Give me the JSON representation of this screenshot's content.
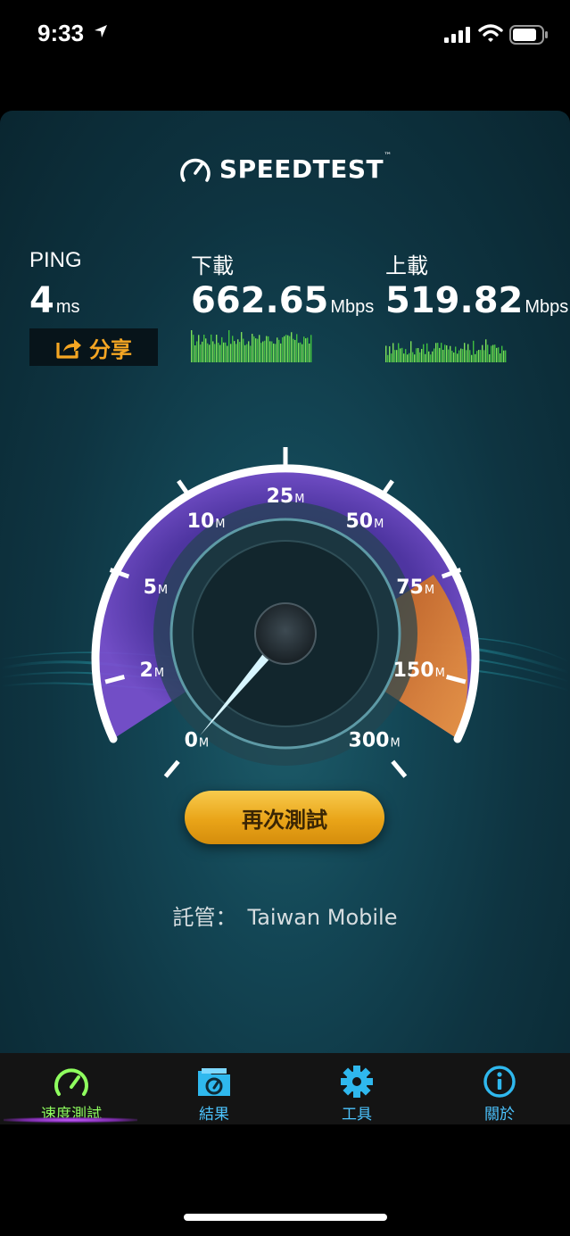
{
  "status": {
    "time": "9:33"
  },
  "app": {
    "logo_text": "SPEEDTEST",
    "logo_tm": "™"
  },
  "metrics": {
    "ping": {
      "label": "PING",
      "value": "4",
      "unit": "ms"
    },
    "download": {
      "label": "下載",
      "value": "662.65",
      "unit": "Mbps"
    },
    "upload": {
      "label": "上載",
      "value": "519.82",
      "unit": "Mbps"
    }
  },
  "share": {
    "label": "分享",
    "icon": "share-icon"
  },
  "gauge": {
    "scale": [
      "0",
      "2",
      "5",
      "10",
      "25",
      "50",
      "75",
      "150",
      "300"
    ],
    "scale_unit": "M",
    "needle_value_mbps": 0
  },
  "retest": {
    "label": "再次測試"
  },
  "host": {
    "label": "託管：",
    "name": "Taiwan Mobile"
  },
  "tabs": [
    {
      "label": "速度測試",
      "icon": "speedometer-icon",
      "active": true
    },
    {
      "label": "結果",
      "icon": "results-folder-icon",
      "active": false
    },
    {
      "label": "工具",
      "icon": "gear-icon",
      "active": false
    },
    {
      "label": "關於",
      "icon": "info-icon",
      "active": false
    }
  ],
  "colors": {
    "accent_orange": "#f5a623",
    "tab_active": "#8fff5f",
    "tab_inactive": "#4cc4ff",
    "gauge_purple": "#6f3fb8"
  }
}
